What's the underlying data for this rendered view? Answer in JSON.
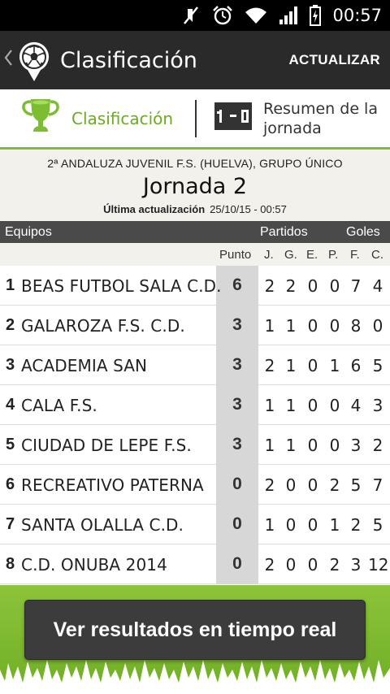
{
  "status_bar": {
    "time": "00:57"
  },
  "action_bar": {
    "title": "Clasificación",
    "action_label": "ACTUALIZAR"
  },
  "tabs": [
    {
      "label": "Clasificación"
    },
    {
      "label": "Resumen de la jornada"
    }
  ],
  "league": {
    "name": "2ª ANDALUZA JUVENIL F.S. (HUELVA), GRUPO ÚNICO",
    "round": "Jornada 2",
    "last_update_label": "Última actualización",
    "last_update_value": "25/10/15 - 00:57"
  },
  "table": {
    "header": {
      "teams": "Equipos",
      "matches": "Partidos",
      "goals": "Goles"
    },
    "subheader": {
      "points": "Punto",
      "j": "J.",
      "g": "G.",
      "e": "E.",
      "p": "P.",
      "f": "F.",
      "c": "C."
    },
    "rows": [
      {
        "pos": "1",
        "team": "BEAS FUTBOL SALA C.D.",
        "pts": "6",
        "j": "2",
        "g": "2",
        "e": "0",
        "p": "0",
        "f": "7",
        "c": "4"
      },
      {
        "pos": "2",
        "team": "GALAROZA F.S. C.D.",
        "pts": "3",
        "j": "1",
        "g": "1",
        "e": "0",
        "p": "0",
        "f": "8",
        "c": "0"
      },
      {
        "pos": "3",
        "team": "ACADEMIA SAN",
        "pts": "3",
        "j": "2",
        "g": "1",
        "e": "0",
        "p": "1",
        "f": "6",
        "c": "5"
      },
      {
        "pos": "4",
        "team": "CALA F.S.",
        "pts": "3",
        "j": "1",
        "g": "1",
        "e": "0",
        "p": "0",
        "f": "4",
        "c": "3"
      },
      {
        "pos": "5",
        "team": "CIUDAD DE LEPE F.S.",
        "pts": "3",
        "j": "1",
        "g": "1",
        "e": "0",
        "p": "0",
        "f": "3",
        "c": "2"
      },
      {
        "pos": "6",
        "team": "RECREATIVO PATERNA",
        "pts": "0",
        "j": "2",
        "g": "0",
        "e": "0",
        "p": "2",
        "f": "5",
        "c": "7"
      },
      {
        "pos": "7",
        "team": "SANTA OLALLA C.D.",
        "pts": "0",
        "j": "1",
        "g": "0",
        "e": "0",
        "p": "1",
        "f": "2",
        "c": "5"
      },
      {
        "pos": "8",
        "team": "C.D. ONUBA 2014",
        "pts": "0",
        "j": "2",
        "g": "0",
        "e": "0",
        "p": "2",
        "f": "3",
        "c": "12"
      }
    ]
  },
  "cta": {
    "label": "Ver resultados en tiempo real"
  },
  "colors": {
    "accent_green": "#7cbd32",
    "action_bar": "#2a2a2a",
    "header_dark": "#4a4a4a",
    "points_column": "#d7d7d7"
  },
  "icons": [
    "mute-icon",
    "alarm-icon",
    "wifi-icon",
    "signal-icon",
    "battery-icon",
    "back-chevron-icon",
    "soccer-ball-logo",
    "trophy-icon",
    "scoreboard-icon"
  ]
}
